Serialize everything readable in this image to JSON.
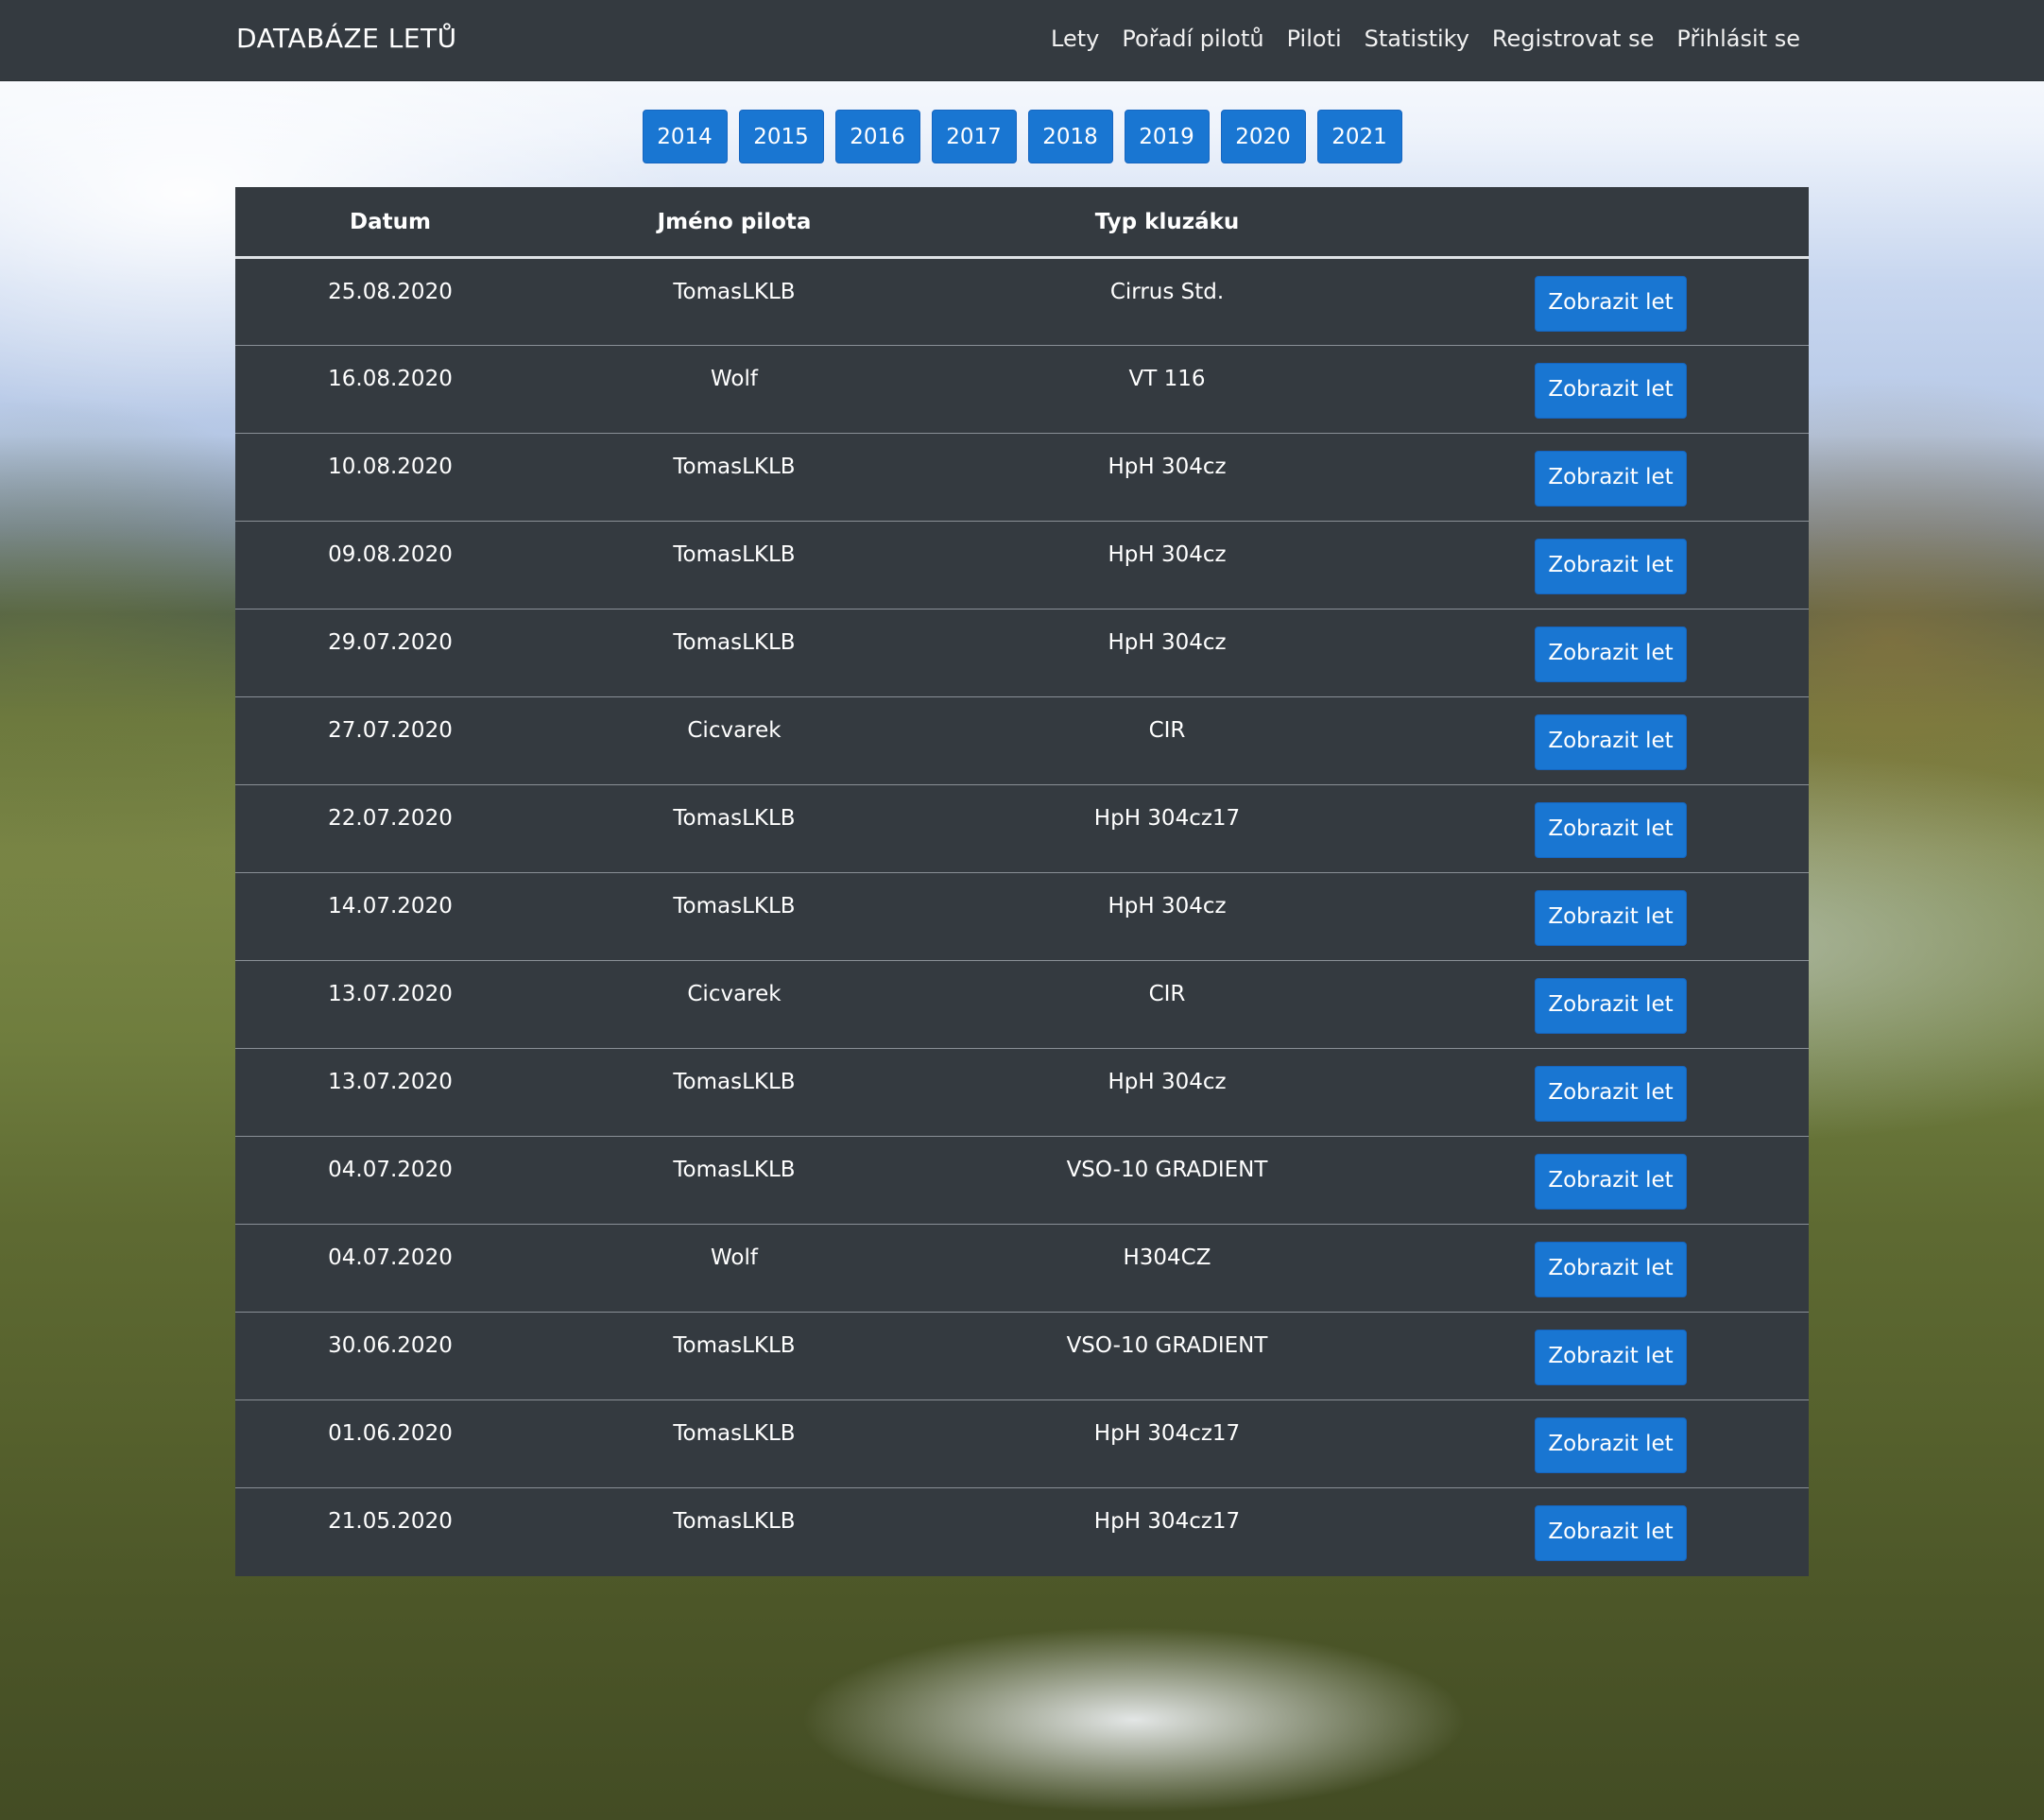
{
  "navbar": {
    "brand": "DATABÁZE LETŮ",
    "links": [
      "Lety",
      "Pořadí pilotů",
      "Piloti",
      "Statistiky",
      "Registrovat se",
      "Přihlásit se"
    ]
  },
  "years": [
    "2014",
    "2015",
    "2016",
    "2017",
    "2018",
    "2019",
    "2020",
    "2021"
  ],
  "table": {
    "headers": [
      "Datum",
      "Jméno pilota",
      "Typ kluzáku",
      ""
    ],
    "button_label": "Zobrazit let",
    "rows": [
      {
        "date": "25.08.2020",
        "pilot": "TomasLKLB",
        "glider": "Cirrus Std."
      },
      {
        "date": "16.08.2020",
        "pilot": "Wolf",
        "glider": "VT 116"
      },
      {
        "date": "10.08.2020",
        "pilot": "TomasLKLB",
        "glider": "HpH 304cz"
      },
      {
        "date": "09.08.2020",
        "pilot": "TomasLKLB",
        "glider": "HpH 304cz"
      },
      {
        "date": "29.07.2020",
        "pilot": "TomasLKLB",
        "glider": "HpH 304cz"
      },
      {
        "date": "27.07.2020",
        "pilot": "Cicvarek",
        "glider": "CIR"
      },
      {
        "date": "22.07.2020",
        "pilot": "TomasLKLB",
        "glider": "HpH 304cz17"
      },
      {
        "date": "14.07.2020",
        "pilot": "TomasLKLB",
        "glider": "HpH 304cz"
      },
      {
        "date": "13.07.2020",
        "pilot": "Cicvarek",
        "glider": "CIR"
      },
      {
        "date": "13.07.2020",
        "pilot": "TomasLKLB",
        "glider": "HpH 304cz"
      },
      {
        "date": "04.07.2020",
        "pilot": "TomasLKLB",
        "glider": "VSO-10 GRADIENT"
      },
      {
        "date": "04.07.2020",
        "pilot": "Wolf",
        "glider": "H304CZ"
      },
      {
        "date": "30.06.2020",
        "pilot": "TomasLKLB",
        "glider": "VSO-10 GRADIENT"
      },
      {
        "date": "01.06.2020",
        "pilot": "TomasLKLB",
        "glider": "HpH 304cz17"
      },
      {
        "date": "21.05.2020",
        "pilot": "TomasLKLB",
        "glider": "HpH 304cz17"
      }
    ]
  }
}
